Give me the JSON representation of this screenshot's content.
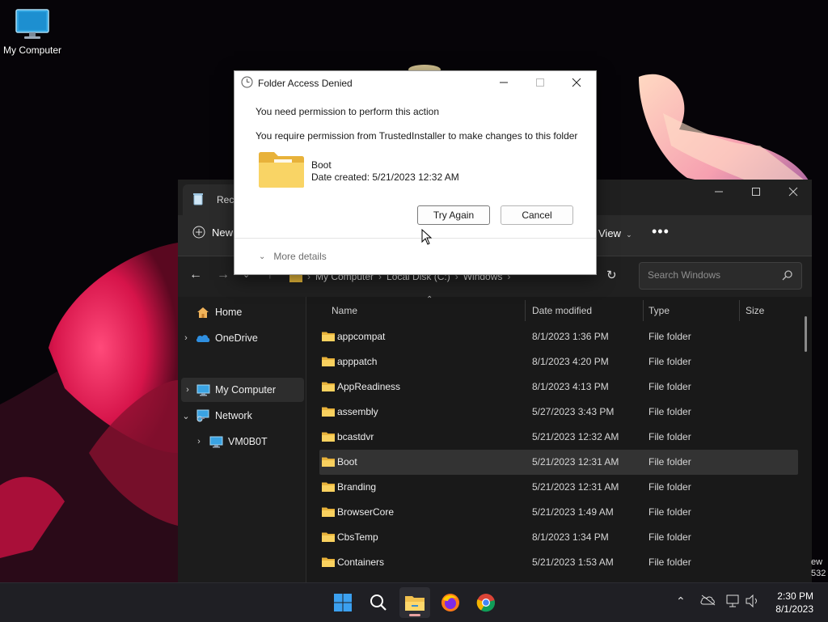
{
  "desktop": {
    "icon_label": "My Computer",
    "edition_watermark": [
      "ew",
      "532"
    ]
  },
  "explorer": {
    "tab_title": "Recy",
    "toolbar": {
      "new_label": "New",
      "view_label": "View",
      "more_label": "•••"
    },
    "address": {
      "crumbs": [
        "My Computer",
        "Local Disk (C:)",
        "Windows"
      ]
    },
    "search": {
      "placeholder": "Search Windows"
    },
    "sidebar": [
      {
        "label": "Home",
        "icon": "home-icon",
        "expander": ""
      },
      {
        "label": "OneDrive",
        "icon": "cloud-icon",
        "expander": "›"
      },
      {
        "label": "My Computer",
        "icon": "computer-icon",
        "expander": "›"
      },
      {
        "label": "Network",
        "icon": "network-icon",
        "expander": "⌄"
      },
      {
        "label": "VM0B0T",
        "icon": "computer-icon",
        "expander": "›"
      }
    ],
    "columns": {
      "name": "Name",
      "date": "Date modified",
      "type": "Type",
      "size": "Size"
    },
    "rows": [
      {
        "name": "appcompat",
        "date": "8/1/2023 1:36 PM",
        "type": "File folder"
      },
      {
        "name": "apppatch",
        "date": "8/1/2023 4:20 PM",
        "type": "File folder"
      },
      {
        "name": "AppReadiness",
        "date": "8/1/2023 4:13 PM",
        "type": "File folder"
      },
      {
        "name": "assembly",
        "date": "5/27/2023 3:43 PM",
        "type": "File folder"
      },
      {
        "name": "bcastdvr",
        "date": "5/21/2023 12:32 AM",
        "type": "File folder"
      },
      {
        "name": "Boot",
        "date": "5/21/2023 12:31 AM",
        "type": "File folder"
      },
      {
        "name": "Branding",
        "date": "5/21/2023 12:31 AM",
        "type": "File folder"
      },
      {
        "name": "BrowserCore",
        "date": "5/21/2023 1:49 AM",
        "type": "File folder"
      },
      {
        "name": "CbsTemp",
        "date": "8/1/2023 1:34 PM",
        "type": "File folder"
      },
      {
        "name": "Containers",
        "date": "5/21/2023 1:53 AM",
        "type": "File folder"
      }
    ],
    "selected_row": 5
  },
  "dialog": {
    "title": "Folder Access Denied",
    "message1": "You need permission to perform this action",
    "message2": "You require permission from TrustedInstaller to make changes to this folder",
    "folder_name": "Boot",
    "folder_date": "Date created: 5/21/2023 12:32 AM",
    "try_again": "Try Again",
    "cancel": "Cancel",
    "more_details": "More details"
  },
  "taskbar": {
    "time": "2:30 PM",
    "date": "8/1/2023"
  }
}
